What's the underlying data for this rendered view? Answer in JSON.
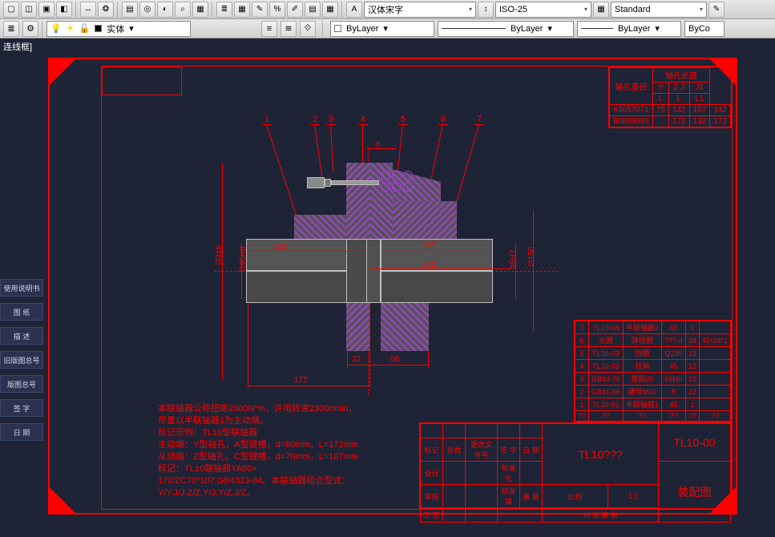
{
  "toolbar": {
    "font_combo": "汉体宋字",
    "dimstyle_combo": "ISO-25",
    "tablestyle_combo": "Standard"
  },
  "props_bar": {
    "layer_name": "实体",
    "color_bylayer": "ByLayer",
    "ltype_bylayer": "ByLayer",
    "lweight_bylayer": "ByLayer",
    "plot_bylayer": "ByCo"
  },
  "status_text": "连线框]",
  "left_tabs": [
    "使用说明书",
    "图 纸",
    "描 述",
    "旧版图总号",
    "版图总号",
    "签 字",
    "日 期"
  ],
  "title_small": "",
  "dim_table": {
    "header1": "轴孔直径",
    "header2": "轴孔长度",
    "sub": [
      "Y",
      "Z J",
      "J1"
    ],
    "sub2": [
      "L",
      "L",
      "L1"
    ],
    "rows": [
      [
        "63657071",
        "75",
        "142",
        "107",
        "142"
      ],
      [
        "80859095",
        " ",
        "172",
        "132",
        "172"
      ]
    ]
  },
  "leaders": [
    "1",
    "2",
    "3",
    "4",
    "5",
    "6",
    "7"
  ],
  "dims": {
    "d315": "∅315",
    "d95h8": "∅95H8",
    "d150": "∅150",
    "h95h7": "95H7",
    "l132": "132",
    "l107": "107",
    "l142": "142",
    "l172": "172",
    "l22": "22",
    "l58": "58",
    "b8": "8"
  },
  "notes": [
    "本联轴器公称扭矩2000N*m，许用转速2300r/min，",
    "尽量以半联轴器1为主动端。",
    "标记示例：TL10型联轴器",
    "主动端：Y型轴孔，A型键槽，d=80mm，L=172mm",
    "从动端：Z型轴孔，C型键槽，d=70mm，L=107mm",
    "标记：TL10联轴器YA80×",
    "172/ZC70*107.GB4323-84。本联轴器组合型式：",
    "Y/Y.J/J.Z/Z.Y/J.Y/Z.J/Z。"
  ],
  "parts": [
    [
      "7",
      "TL10-04",
      "半联轴器2",
      "45",
      "1",
      ""
    ],
    [
      "6",
      "无图",
      "弹性圈",
      "???-4",
      "48",
      "45*24*1"
    ],
    [
      "5",
      "TL10-03",
      "挡圈",
      "Q235",
      "12",
      ""
    ],
    [
      "4",
      "TL10-02",
      "柱销",
      "45",
      "12",
      ""
    ],
    [
      "3",
      "GB93-76",
      "垫圈20",
      "65Mn",
      "12",
      ""
    ],
    [
      "2",
      "GB41-86",
      "螺母M20",
      "8",
      "12",
      ""
    ],
    [
      "1",
      "TL10-01",
      "半联轴器1",
      "45",
      "1",
      ""
    ],
    [
      "??",
      "??",
      "??",
      "??",
      "??",
      "??"
    ]
  ],
  "title_block": {
    "main": "TL10???",
    "number": "TL10-00",
    "subtitle": "装配图",
    "scale": "1:1",
    "labels": [
      "标准媒",
      "标记",
      "处数",
      "更改文件号",
      "签 字",
      "日 期",
      "重 量",
      "比例",
      "设计",
      "标准化",
      "审核",
      "工 艺",
      "共 张 第 张"
    ]
  }
}
